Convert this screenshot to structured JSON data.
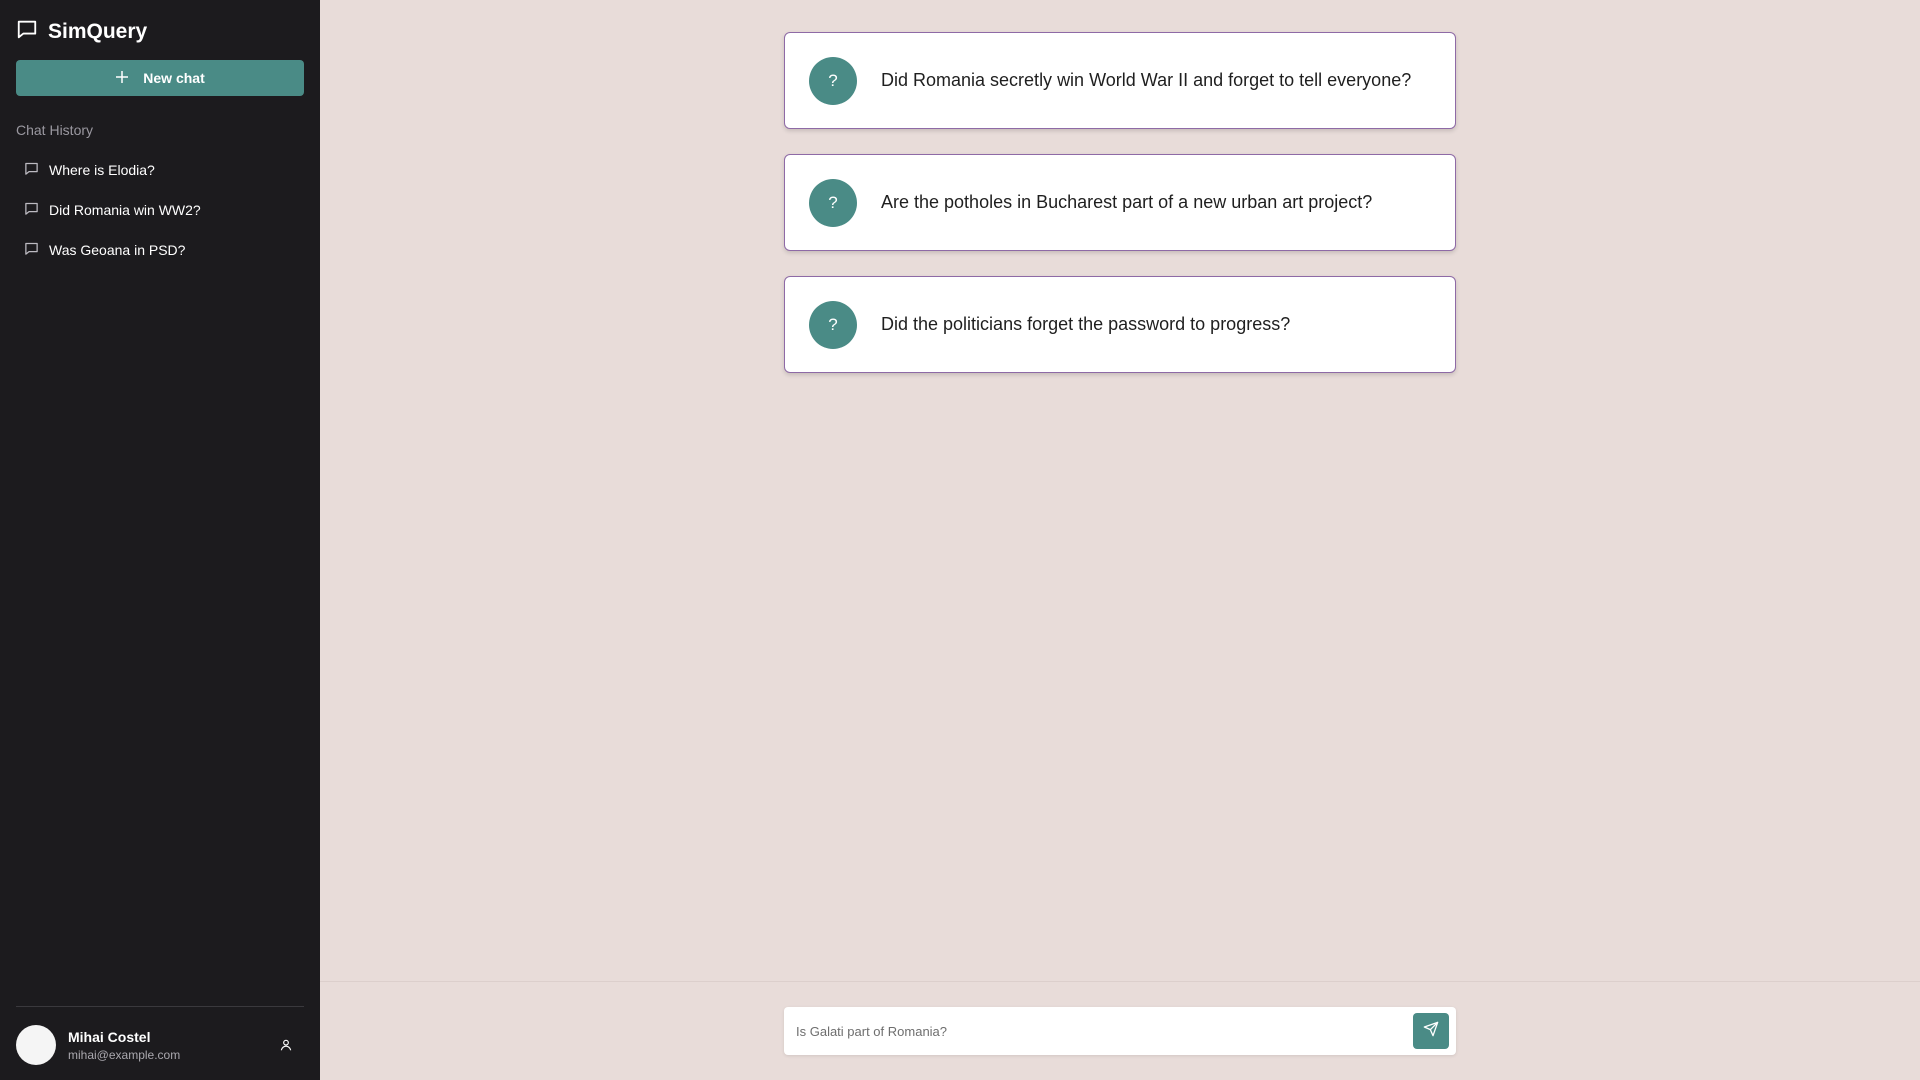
{
  "app": {
    "title": "SimQuery"
  },
  "sidebar": {
    "new_chat_label": "New chat",
    "history_label": "Chat History",
    "items": [
      {
        "label": "Where is Elodia?"
      },
      {
        "label": "Did Romania win WW2?"
      },
      {
        "label": "Was Geoana in PSD?"
      }
    ],
    "user": {
      "name": "Mihai Costel",
      "email": "mihai@example.com"
    }
  },
  "main": {
    "suggestions": [
      {
        "icon": "?",
        "text": "Did Romania secretly win World War II and forget to tell everyone?"
      },
      {
        "icon": "?",
        "text": "Are the potholes in Bucharest part of a new urban art project?"
      },
      {
        "icon": "?",
        "text": "Did the politicians forget the password to progress?"
      }
    ],
    "input": {
      "placeholder": "Is Galati part of Romania?",
      "value": ""
    }
  },
  "colors": {
    "sidebar_bg": "#1c1b1e",
    "accent": "#4a8b86",
    "main_bg": "#e8dcd9",
    "card_border": "#8e6aa6"
  },
  "icons": {
    "brand": "chat-bubble-icon",
    "new_chat": "plus-icon",
    "history_item": "chat-bubble-icon",
    "user_profile": "user-icon",
    "send": "send-icon"
  }
}
